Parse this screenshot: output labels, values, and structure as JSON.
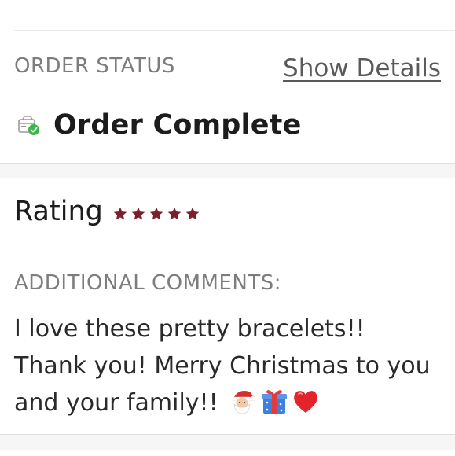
{
  "order_status": {
    "label": "ORDER STATUS",
    "details_link": "Show Details",
    "status_text": "Order Complete",
    "status_icon": "package-check-icon",
    "check_color": "#3bb54a"
  },
  "rating": {
    "label": "Rating",
    "stars": 5,
    "max_stars": 5,
    "star_color": "#7c1f2c"
  },
  "comments": {
    "label": "ADDITIONAL COMMENTS:",
    "text": "I love these pretty bracelets!! Thank you! Merry Christmas to you and your family!!",
    "emojis": [
      "santa-emoji",
      "gift-emoji",
      "red-heart-emoji"
    ]
  }
}
